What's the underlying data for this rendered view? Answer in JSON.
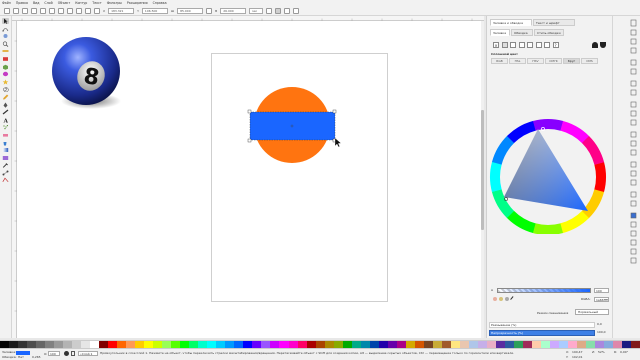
{
  "menubar": {
    "items": [
      "Файл",
      "Правка",
      "Вид",
      "Слой",
      "Объект",
      "Контур",
      "Текст",
      "Фильтры",
      "Расширения",
      "Справка"
    ]
  },
  "controls": {
    "x_label": "X",
    "x_value": "183.321",
    "y_label": "Y",
    "y_value": "106.500",
    "w_label": "Ш",
    "w_value": "85.000",
    "h_label": "В",
    "h_value": "26.000",
    "unit": "мм"
  },
  "dialog": {
    "tab_fill_label": "Заливка и обводка",
    "tab_text_label": "Текст и шрифт",
    "subtab_fill": "Заливка",
    "subtab_stroke_paint": "Обводка",
    "subtab_stroke_style": "Стиль обводки",
    "flat_color_label": "Сплошной цвет",
    "modes": [
      "RGB",
      "HSL",
      "HSV",
      "CMYK",
      "Круг",
      "CMS"
    ],
    "selected_mode": "Круг",
    "alpha_label": "A",
    "alpha_value": "100",
    "rgba_label": "RGBA:",
    "rgba_value": "1a66ffff",
    "blend_label": "Режим смешивания",
    "blend_value": "Нормальный",
    "blur_label": "Размывание (%)",
    "blur_value": "0,0",
    "opacity_label": "Непрозрачность (%)",
    "opacity_value": "100,0"
  },
  "status": {
    "fill_label": "Заливка:",
    "stroke_label": "Обводка:",
    "stroke_value": "Нет",
    "stroke_width": "0,265",
    "opacity_label": "O:",
    "opacity_value": "100",
    "layer_value": "•Слой 1",
    "message": "Прямоугольник в слое Слой 1. Нажмите на объект, чтобы переключить стрелки масштабирования/вращения. Перетаскивайте объект с Shift для создания копии, Alt — выделение скрытых объектов, Ctrl — перемещение только по горизонтали или вертикали.",
    "x_label": "X:",
    "x_value": "190,47",
    "y_label": "Y:",
    "y_value": "102,01",
    "z_label": "Z:",
    "z_value": "52%",
    "r_label": "R:",
    "r_value": "0,00°"
  },
  "canvas": {
    "ball_number": "8",
    "colors": {
      "fill_blue": "#1a66ff",
      "circle_orange": "#ff7410",
      "ball_blue": "#2a48c9"
    }
  },
  "palette": [
    "#000000",
    "#1a1a1a",
    "#333333",
    "#4d4d4d",
    "#666666",
    "#808080",
    "#999999",
    "#b3b3b3",
    "#cccccc",
    "#e6e6e6",
    "#ffffff",
    "#800000",
    "#ff0000",
    "#ff6600",
    "#ff9955",
    "#ffcc00",
    "#ffff00",
    "#ccff00",
    "#99ff55",
    "#55ff00",
    "#00ff00",
    "#00ff66",
    "#00ffcc",
    "#00ffff",
    "#00ccff",
    "#0099ff",
    "#0066ff",
    "#0000ff",
    "#6600ff",
    "#9955ff",
    "#cc00ff",
    "#ff00ff",
    "#ff00cc",
    "#ff0066",
    "#aa0000",
    "#aa4400",
    "#aa8800",
    "#88aa00",
    "#00aa00",
    "#00aa88",
    "#0088aa",
    "#0044aa",
    "#2200aa",
    "#6600aa",
    "#aa0088",
    "#d4aa00",
    "#d45500",
    "#784421",
    "#c8ab37",
    "#a05a2c",
    "#ffe680",
    "#e9c6af",
    "#afc6e9",
    "#c6afe9",
    "#e9afc6",
    "#5a2ca0",
    "#2c5aa0",
    "#2ca05a",
    "#a02c5a",
    "#ffccaa",
    "#aaffcc",
    "#ccaaff",
    "#aaccff",
    "#ffaacc",
    "#deaa87",
    "#87deaa",
    "#aa87de",
    "#87aade",
    "#de87aa",
    "#1a1a80",
    "#801a1a"
  ]
}
